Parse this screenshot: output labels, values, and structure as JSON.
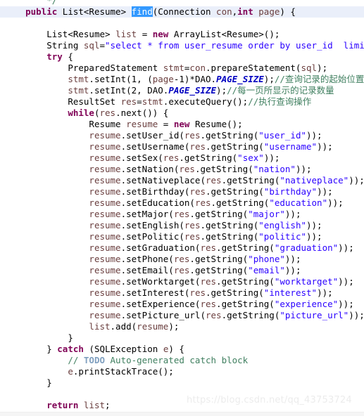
{
  "editor": {
    "language": "java",
    "theme": "eclipse-light",
    "colors": {
      "background": "#ffffff",
      "keyword": "#7f0055",
      "string": "#2a00ff",
      "comment": "#3f7f5f",
      "comment_tag": "#7f9fbf",
      "static_field": "#0000c0",
      "local_variable": "#6a3e3e",
      "selection_background": "#3399ff",
      "selection_foreground": "#ffffff",
      "current_line_background": "#eaeffa",
      "watermark": "#ececec"
    },
    "selected_token": "find",
    "watermark": "https://blog.csdn.net/qq_43753724"
  },
  "code": {
    "lines": [
      {
        "id": "l01",
        "indent": 2,
        "clipped_top": true,
        "tokens": [
          {
            "t": "*/",
            "c": "cmt"
          }
        ]
      },
      {
        "id": "l02",
        "indent": 1,
        "current": true,
        "tokens": [
          {
            "t": "public",
            "c": "kw"
          },
          {
            "t": " List<Resume> ",
            "c": "plain"
          },
          {
            "t": "find",
            "c": "sel"
          },
          {
            "t": "(Connection ",
            "c": "plain"
          },
          {
            "t": "con",
            "c": "var"
          },
          {
            "t": ",",
            "c": "plain"
          },
          {
            "t": "int",
            "c": "kw"
          },
          {
            "t": " ",
            "c": "plain"
          },
          {
            "t": "page",
            "c": "var"
          },
          {
            "t": ") {",
            "c": "plain"
          }
        ]
      },
      {
        "id": "l03",
        "indent": 0,
        "tokens": []
      },
      {
        "id": "l04",
        "indent": 2,
        "tokens": [
          {
            "t": "List<Resume> ",
            "c": "plain"
          },
          {
            "t": "list",
            "c": "var"
          },
          {
            "t": " = ",
            "c": "plain"
          },
          {
            "t": "new",
            "c": "kw"
          },
          {
            "t": " ArrayList<Resume>();",
            "c": "plain"
          }
        ]
      },
      {
        "id": "l05",
        "indent": 2,
        "tokens": [
          {
            "t": "String ",
            "c": "plain"
          },
          {
            "t": "sql",
            "c": "var"
          },
          {
            "t": "=",
            "c": "plain"
          },
          {
            "t": "\"select * from user_resume order by user_id  limit ?,?",
            "c": "str"
          }
        ]
      },
      {
        "id": "l06",
        "indent": 2,
        "tokens": [
          {
            "t": "try",
            "c": "kw"
          },
          {
            "t": " {",
            "c": "plain"
          }
        ]
      },
      {
        "id": "l07",
        "indent": 3,
        "tokens": [
          {
            "t": "PreparedStatement ",
            "c": "plain"
          },
          {
            "t": "stmt",
            "c": "var"
          },
          {
            "t": "=",
            "c": "plain"
          },
          {
            "t": "con",
            "c": "var"
          },
          {
            "t": ".prepareStatement(",
            "c": "plain"
          },
          {
            "t": "sql",
            "c": "var"
          },
          {
            "t": ");",
            "c": "plain"
          }
        ]
      },
      {
        "id": "l08",
        "indent": 3,
        "tokens": [
          {
            "t": "stmt",
            "c": "var"
          },
          {
            "t": ".setInt(1, (",
            "c": "plain"
          },
          {
            "t": "page",
            "c": "var"
          },
          {
            "t": "-1)*DAO.",
            "c": "plain"
          },
          {
            "t": "PAGE_SIZE",
            "c": "fld"
          },
          {
            "t": ");",
            "c": "plain"
          },
          {
            "t": "//查询记录的起始位置",
            "c": "cmt"
          }
        ]
      },
      {
        "id": "l09",
        "indent": 3,
        "tokens": [
          {
            "t": "stmt",
            "c": "var"
          },
          {
            "t": ".setInt(2, DAO.",
            "c": "plain"
          },
          {
            "t": "PAGE_SIZE",
            "c": "fld"
          },
          {
            "t": ");",
            "c": "plain"
          },
          {
            "t": "//每一页所显示的记录数量",
            "c": "cmt"
          }
        ]
      },
      {
        "id": "l10",
        "indent": 3,
        "tokens": [
          {
            "t": "ResultSet ",
            "c": "plain"
          },
          {
            "t": "res",
            "c": "var"
          },
          {
            "t": "=",
            "c": "plain"
          },
          {
            "t": "stmt",
            "c": "var"
          },
          {
            "t": ".executeQuery();",
            "c": "plain"
          },
          {
            "t": "//执行查询操作",
            "c": "cmt"
          }
        ]
      },
      {
        "id": "l11",
        "indent": 3,
        "tokens": [
          {
            "t": "while",
            "c": "kw"
          },
          {
            "t": "(",
            "c": "plain"
          },
          {
            "t": "res",
            "c": "var"
          },
          {
            "t": ".next()) {",
            "c": "plain"
          }
        ]
      },
      {
        "id": "l12",
        "indent": 4,
        "tokens": [
          {
            "t": "Resume ",
            "c": "plain"
          },
          {
            "t": "resume",
            "c": "var"
          },
          {
            "t": " = ",
            "c": "plain"
          },
          {
            "t": "new",
            "c": "kw"
          },
          {
            "t": " Resume();",
            "c": "plain"
          }
        ]
      },
      {
        "id": "l13",
        "indent": 4,
        "tokens": [
          {
            "t": "resume",
            "c": "var"
          },
          {
            "t": ".setUser_id(",
            "c": "plain"
          },
          {
            "t": "res",
            "c": "var"
          },
          {
            "t": ".getString(",
            "c": "plain"
          },
          {
            "t": "\"user_id\"",
            "c": "str"
          },
          {
            "t": "));",
            "c": "plain"
          }
        ]
      },
      {
        "id": "l14",
        "indent": 4,
        "tokens": [
          {
            "t": "resume",
            "c": "var"
          },
          {
            "t": ".setUsername(",
            "c": "plain"
          },
          {
            "t": "res",
            "c": "var"
          },
          {
            "t": ".getString(",
            "c": "plain"
          },
          {
            "t": "\"username\"",
            "c": "str"
          },
          {
            "t": "));",
            "c": "plain"
          }
        ]
      },
      {
        "id": "l15",
        "indent": 4,
        "tokens": [
          {
            "t": "resume",
            "c": "var"
          },
          {
            "t": ".setSex(",
            "c": "plain"
          },
          {
            "t": "res",
            "c": "var"
          },
          {
            "t": ".getString(",
            "c": "plain"
          },
          {
            "t": "\"sex\"",
            "c": "str"
          },
          {
            "t": "));",
            "c": "plain"
          }
        ]
      },
      {
        "id": "l16",
        "indent": 4,
        "tokens": [
          {
            "t": "resume",
            "c": "var"
          },
          {
            "t": ".setNation(",
            "c": "plain"
          },
          {
            "t": "res",
            "c": "var"
          },
          {
            "t": ".getString(",
            "c": "plain"
          },
          {
            "t": "\"nation\"",
            "c": "str"
          },
          {
            "t": "));",
            "c": "plain"
          }
        ]
      },
      {
        "id": "l17",
        "indent": 4,
        "tokens": [
          {
            "t": "resume",
            "c": "var"
          },
          {
            "t": ".setNativeplace(",
            "c": "plain"
          },
          {
            "t": "res",
            "c": "var"
          },
          {
            "t": ".getString(",
            "c": "plain"
          },
          {
            "t": "\"nativeplace\"",
            "c": "str"
          },
          {
            "t": "));",
            "c": "plain"
          }
        ]
      },
      {
        "id": "l18",
        "indent": 4,
        "tokens": [
          {
            "t": "resume",
            "c": "var"
          },
          {
            "t": ".setBirthday(",
            "c": "plain"
          },
          {
            "t": "res",
            "c": "var"
          },
          {
            "t": ".getString(",
            "c": "plain"
          },
          {
            "t": "\"birthday\"",
            "c": "str"
          },
          {
            "t": "));",
            "c": "plain"
          }
        ]
      },
      {
        "id": "l19",
        "indent": 4,
        "tokens": [
          {
            "t": "resume",
            "c": "var"
          },
          {
            "t": ".setEducation(",
            "c": "plain"
          },
          {
            "t": "res",
            "c": "var"
          },
          {
            "t": ".getString(",
            "c": "plain"
          },
          {
            "t": "\"education\"",
            "c": "str"
          },
          {
            "t": "));",
            "c": "plain"
          }
        ]
      },
      {
        "id": "l20",
        "indent": 4,
        "tokens": [
          {
            "t": "resume",
            "c": "var"
          },
          {
            "t": ".setMajor(",
            "c": "plain"
          },
          {
            "t": "res",
            "c": "var"
          },
          {
            "t": ".getString(",
            "c": "plain"
          },
          {
            "t": "\"major\"",
            "c": "str"
          },
          {
            "t": "));",
            "c": "plain"
          }
        ]
      },
      {
        "id": "l21",
        "indent": 4,
        "tokens": [
          {
            "t": "resume",
            "c": "var"
          },
          {
            "t": ".setEnglish(",
            "c": "plain"
          },
          {
            "t": "res",
            "c": "var"
          },
          {
            "t": ".getString(",
            "c": "plain"
          },
          {
            "t": "\"english\"",
            "c": "str"
          },
          {
            "t": "));",
            "c": "plain"
          }
        ]
      },
      {
        "id": "l22",
        "indent": 4,
        "tokens": [
          {
            "t": "resume",
            "c": "var"
          },
          {
            "t": ".setPolitic(",
            "c": "plain"
          },
          {
            "t": "res",
            "c": "var"
          },
          {
            "t": ".getString(",
            "c": "plain"
          },
          {
            "t": "\"politic\"",
            "c": "str"
          },
          {
            "t": "));",
            "c": "plain"
          }
        ]
      },
      {
        "id": "l23",
        "indent": 4,
        "tokens": [
          {
            "t": "resume",
            "c": "var"
          },
          {
            "t": ".setGraduation(",
            "c": "plain"
          },
          {
            "t": "res",
            "c": "var"
          },
          {
            "t": ".getString(",
            "c": "plain"
          },
          {
            "t": "\"graduation\"",
            "c": "str"
          },
          {
            "t": "));",
            "c": "plain"
          }
        ]
      },
      {
        "id": "l24",
        "indent": 4,
        "tokens": [
          {
            "t": "resume",
            "c": "var"
          },
          {
            "t": ".setPhone(",
            "c": "plain"
          },
          {
            "t": "res",
            "c": "var"
          },
          {
            "t": ".getString(",
            "c": "plain"
          },
          {
            "t": "\"phone\"",
            "c": "str"
          },
          {
            "t": "));",
            "c": "plain"
          }
        ]
      },
      {
        "id": "l25",
        "indent": 4,
        "tokens": [
          {
            "t": "resume",
            "c": "var"
          },
          {
            "t": ".setEmail(",
            "c": "plain"
          },
          {
            "t": "res",
            "c": "var"
          },
          {
            "t": ".getString(",
            "c": "plain"
          },
          {
            "t": "\"email\"",
            "c": "str"
          },
          {
            "t": "));",
            "c": "plain"
          }
        ]
      },
      {
        "id": "l26",
        "indent": 4,
        "tokens": [
          {
            "t": "resume",
            "c": "var"
          },
          {
            "t": ".setWorktarget(",
            "c": "plain"
          },
          {
            "t": "res",
            "c": "var"
          },
          {
            "t": ".getString(",
            "c": "plain"
          },
          {
            "t": "\"worktarget\"",
            "c": "str"
          },
          {
            "t": "));",
            "c": "plain"
          }
        ]
      },
      {
        "id": "l27",
        "indent": 4,
        "tokens": [
          {
            "t": "resume",
            "c": "var"
          },
          {
            "t": ".setInterest(",
            "c": "plain"
          },
          {
            "t": "res",
            "c": "var"
          },
          {
            "t": ".getString(",
            "c": "plain"
          },
          {
            "t": "\"interest\"",
            "c": "str"
          },
          {
            "t": "));",
            "c": "plain"
          }
        ]
      },
      {
        "id": "l28",
        "indent": 4,
        "tokens": [
          {
            "t": "resume",
            "c": "var"
          },
          {
            "t": ".setExperience(",
            "c": "plain"
          },
          {
            "t": "res",
            "c": "var"
          },
          {
            "t": ".getString(",
            "c": "plain"
          },
          {
            "t": "\"experience\"",
            "c": "str"
          },
          {
            "t": "));",
            "c": "plain"
          }
        ]
      },
      {
        "id": "l29",
        "indent": 4,
        "tokens": [
          {
            "t": "resume",
            "c": "var"
          },
          {
            "t": ".setPicture_url(",
            "c": "plain"
          },
          {
            "t": "res",
            "c": "var"
          },
          {
            "t": ".getString(",
            "c": "plain"
          },
          {
            "t": "\"picture_url\"",
            "c": "str"
          },
          {
            "t": "));",
            "c": "plain"
          }
        ]
      },
      {
        "id": "l30",
        "indent": 4,
        "tokens": [
          {
            "t": "list",
            "c": "var"
          },
          {
            "t": ".add(",
            "c": "plain"
          },
          {
            "t": "resume",
            "c": "var"
          },
          {
            "t": ");",
            "c": "plain"
          }
        ]
      },
      {
        "id": "l31",
        "indent": 3,
        "tokens": [
          {
            "t": "}",
            "c": "plain"
          }
        ]
      },
      {
        "id": "l32",
        "indent": 2,
        "tokens": [
          {
            "t": "} ",
            "c": "plain"
          },
          {
            "t": "catch",
            "c": "kw"
          },
          {
            "t": " (SQLException ",
            "c": "plain"
          },
          {
            "t": "e",
            "c": "var"
          },
          {
            "t": ") {",
            "c": "plain"
          }
        ]
      },
      {
        "id": "l33",
        "indent": 3,
        "tokens": [
          {
            "t": "// ",
            "c": "cmt"
          },
          {
            "t": "TODO",
            "c": "cmt-tag"
          },
          {
            "t": " Auto-generated catch block",
            "c": "cmt"
          }
        ]
      },
      {
        "id": "l34",
        "indent": 3,
        "tokens": [
          {
            "t": "e",
            "c": "var"
          },
          {
            "t": ".printStackTrace();",
            "c": "plain"
          }
        ]
      },
      {
        "id": "l35",
        "indent": 2,
        "tokens": [
          {
            "t": "}",
            "c": "plain"
          }
        ]
      },
      {
        "id": "l36",
        "indent": 0,
        "tokens": []
      },
      {
        "id": "l37",
        "indent": 2,
        "tokens": [
          {
            "t": "return",
            "c": "kw"
          },
          {
            "t": " ",
            "c": "plain"
          },
          {
            "t": "list",
            "c": "var"
          },
          {
            "t": ";",
            "c": "plain"
          }
        ]
      },
      {
        "id": "l38",
        "indent": 1,
        "clipped_bottom": true,
        "tokens": [
          {
            "t": "}",
            "c": "plain"
          }
        ]
      }
    ]
  }
}
